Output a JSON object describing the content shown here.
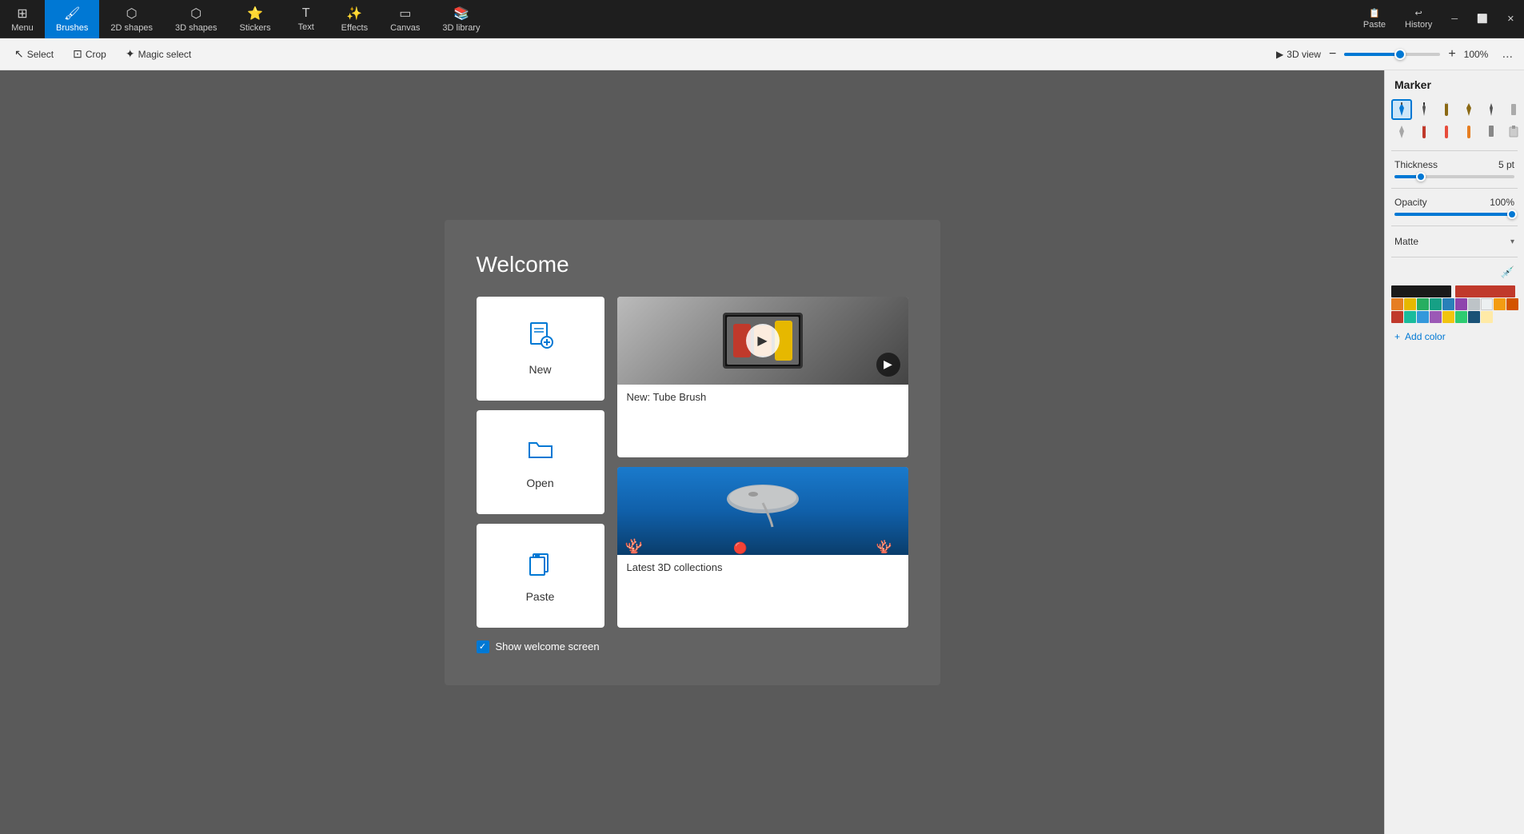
{
  "topToolbar": {
    "menu": {
      "label": "Menu",
      "icon": "⊞"
    },
    "items": [
      {
        "id": "brushes",
        "label": "Brushes",
        "icon": "✏️",
        "active": true
      },
      {
        "id": "2dshapes",
        "label": "2D shapes",
        "icon": "⬡"
      },
      {
        "id": "3dshapes",
        "label": "3D shapes",
        "icon": "⬡"
      },
      {
        "id": "stickers",
        "label": "Stickers",
        "icon": "⭐"
      },
      {
        "id": "text",
        "label": "Text",
        "icon": "T"
      },
      {
        "id": "effects",
        "label": "Effects",
        "icon": "✨"
      },
      {
        "id": "canvas",
        "label": "Canvas",
        "icon": "▭"
      },
      {
        "id": "3dlibrary",
        "label": "3D library",
        "icon": "📚"
      }
    ],
    "rightItems": [
      {
        "id": "paste",
        "label": "Paste",
        "icon": "📋"
      },
      {
        "id": "history",
        "label": "History",
        "icon": "↩"
      }
    ]
  },
  "secondToolbar": {
    "select": {
      "label": "Select",
      "icon": "↖"
    },
    "crop": {
      "label": "Crop",
      "icon": "⊡"
    },
    "magicSelect": {
      "label": "Magic select",
      "icon": "✦"
    },
    "view3d": {
      "label": "3D view",
      "icon": "▶"
    },
    "zoomMinus": "−",
    "zoomPlus": "+",
    "zoomPercent": "100%",
    "more": "..."
  },
  "welcome": {
    "title": "Welcome",
    "cards": [
      {
        "id": "new",
        "icon": "📄",
        "label": "New"
      },
      {
        "id": "open",
        "icon": "📁",
        "label": "Open"
      },
      {
        "id": "paste",
        "icon": "📋",
        "label": "Paste"
      }
    ],
    "mediaCards": [
      {
        "id": "tube-brush",
        "label": "New: Tube Brush",
        "hasPlay": true
      },
      {
        "id": "3d-collections",
        "label": "Latest 3D collections",
        "hasPlay": false
      }
    ],
    "showWelcome": {
      "checked": true,
      "label": "Show welcome screen"
    }
  },
  "rightPanel": {
    "title": "Marker",
    "brushes": [
      {
        "id": "marker1",
        "icon": "✒",
        "selected": true,
        "color": "#0078d4"
      },
      {
        "id": "marker2",
        "icon": "✒",
        "selected": false,
        "color": "#555"
      },
      {
        "id": "marker3",
        "icon": "✒",
        "selected": false,
        "color": "#8B6914"
      },
      {
        "id": "marker4",
        "icon": "✒",
        "selected": false,
        "color": "#555"
      },
      {
        "id": "marker5",
        "icon": "✒",
        "selected": false,
        "color": "#555"
      },
      {
        "id": "marker6",
        "icon": "✒",
        "selected": false,
        "color": "#555"
      },
      {
        "id": "marker7",
        "icon": "✒",
        "selected": false,
        "color": "#555"
      },
      {
        "id": "marker8",
        "icon": "✒",
        "selected": false,
        "color": "#c0392b"
      },
      {
        "id": "marker9",
        "icon": "✒",
        "selected": false,
        "color": "#c0392b"
      },
      {
        "id": "marker10",
        "icon": "✒",
        "selected": false,
        "color": "#e67e22"
      },
      {
        "id": "marker11",
        "icon": "✒",
        "selected": false,
        "color": "#555"
      },
      {
        "id": "marker12",
        "icon": "⬜",
        "selected": false,
        "color": "#888"
      }
    ],
    "thickness": {
      "label": "Thickness",
      "value": "5 pt"
    },
    "opacity": {
      "label": "Opacity",
      "value": "100%"
    },
    "matte": {
      "label": "Matte",
      "icon": "▾"
    },
    "addColor": "+ Add color",
    "colors": [
      "#1a1a1a",
      "#c0392b",
      "#e67e22",
      "#e6b800",
      "#27ae60",
      "#16a085",
      "#2980b9",
      "#8e44ad",
      "#bdc3c7",
      "#ecf0f1",
      "#f39c12",
      "#d35400",
      "#c0392b",
      "#16a085",
      "#1abc9c",
      "#3498db",
      "#9b59b6",
      "#f1c40f",
      "#2ecc71",
      "#1a5276",
      "#ffeaa7",
      "#fdcb6e",
      "#e17055",
      "#d63031",
      "#a29bfe",
      "#6c5ce7",
      "#00b894",
      "#00cec9",
      "#0984e3",
      "#2d3436"
    ]
  }
}
